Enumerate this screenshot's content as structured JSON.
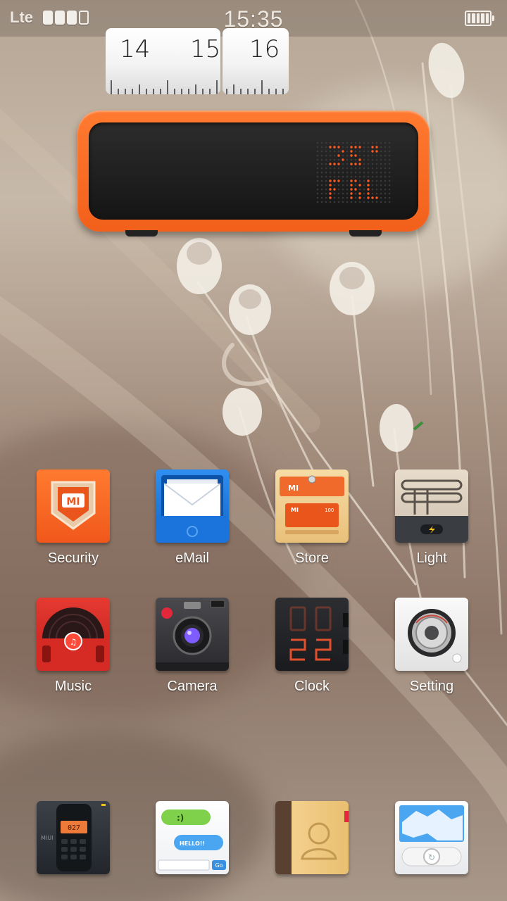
{
  "status_bar": {
    "carrier": "Lte",
    "time": "15:35",
    "signal_bars": 4,
    "signal_filled": 3,
    "battery_icon": "battery-icon"
  },
  "clock_widget": {
    "hour_prev": "14",
    "hour_current": "15",
    "hour_next": "16",
    "temperature_icon": "dot-matrix-display-icon",
    "accent_color": "#f36a22"
  },
  "apps": [
    {
      "label": "Security",
      "icon": "shield-icon"
    },
    {
      "label": "eMail",
      "icon": "mail-icon"
    },
    {
      "label": "Store",
      "icon": "store-icon"
    },
    {
      "label": "Light",
      "icon": "flashlight-icon"
    },
    {
      "label": "Music",
      "icon": "vinyl-record-icon"
    },
    {
      "label": "Camera",
      "icon": "camera-icon"
    },
    {
      "label": "Clock",
      "icon": "digital-clock-icon"
    },
    {
      "label": "Setting",
      "icon": "settings-dial-icon"
    }
  ],
  "dock": [
    {
      "icon": "phone-icon",
      "display_text": "027",
      "brand_text": "MIUI"
    },
    {
      "icon": "messages-icon",
      "bubble1": ":)",
      "bubble2": "HELLO!!",
      "send_label": "Go"
    },
    {
      "icon": "contacts-icon"
    },
    {
      "icon": "browser-icon"
    }
  ],
  "brand": {
    "logo_text": "MI",
    "store_tag": "100"
  }
}
